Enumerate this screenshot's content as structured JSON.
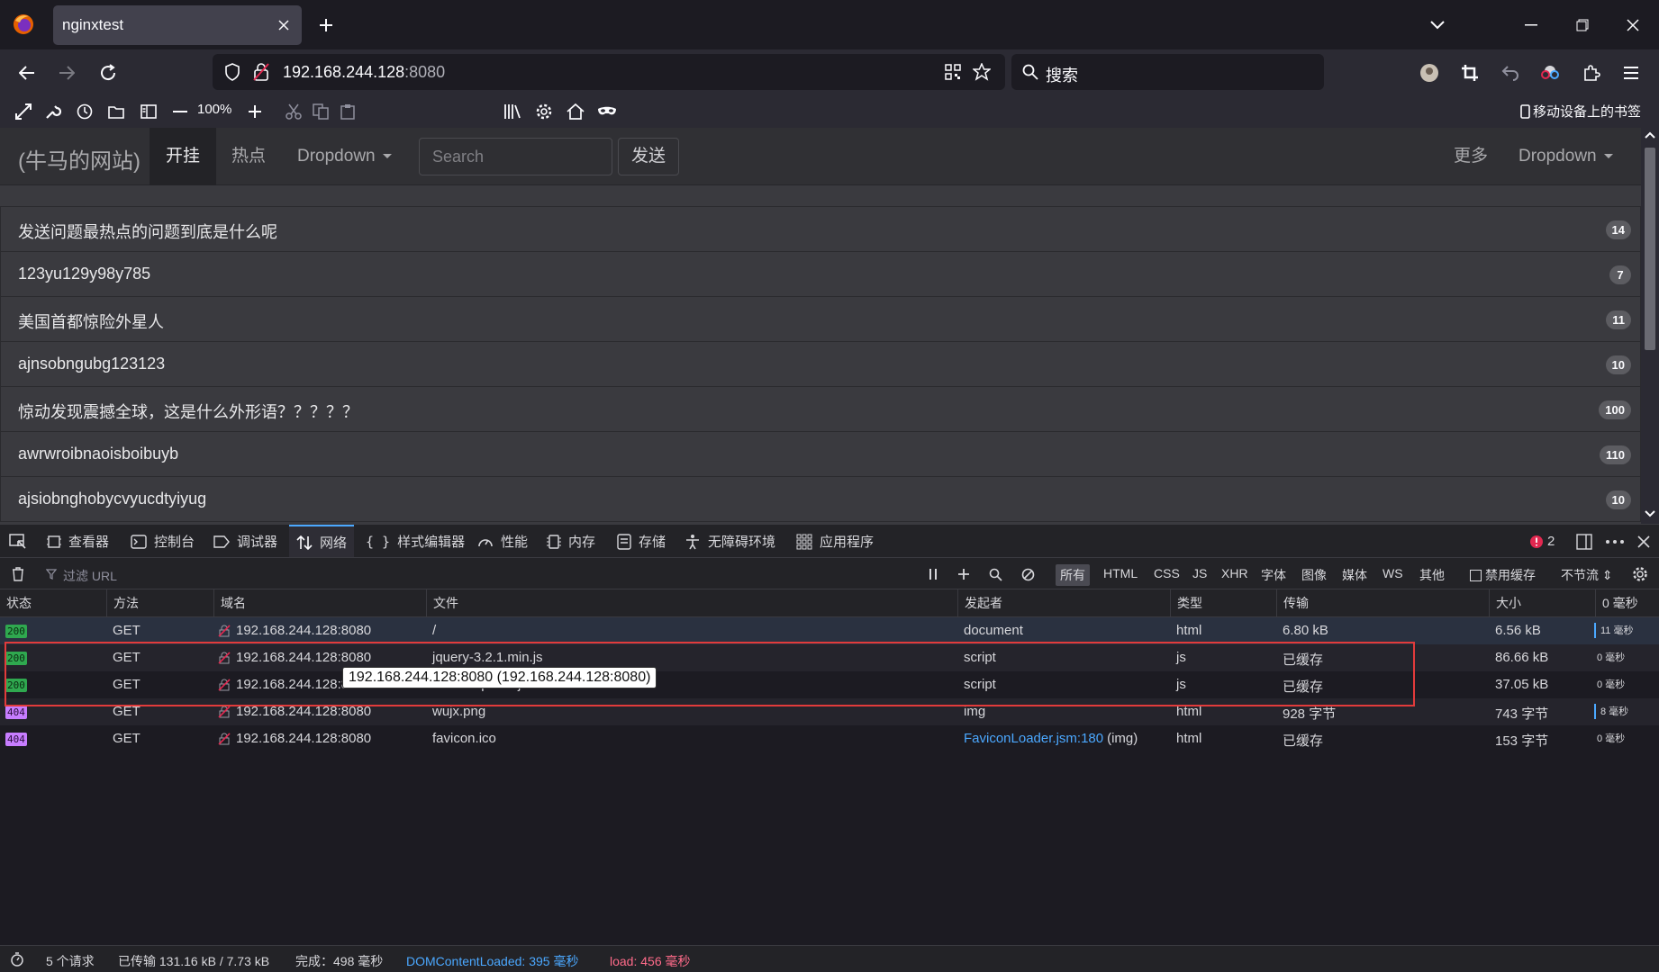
{
  "browser": {
    "tab_title": "nginxtest",
    "url_host": "192.168.244.128",
    "url_port": ":8080",
    "search_placeholder": "搜索",
    "zoom": "100%",
    "mobile_bookmarks": "移动设备上的书签"
  },
  "page": {
    "brand": "(牛马的网站)",
    "nav": [
      "开挂",
      "热点",
      "Dropdown"
    ],
    "search_placeholder": "Search",
    "send_button": "发送",
    "more": "更多",
    "dropdown_right": "Dropdown",
    "items": [
      {
        "text": "发送问题最热点的问题到底是什么呢",
        "badge": "14"
      },
      {
        "text": "123yu129y98y785",
        "badge": "7"
      },
      {
        "text": "美国首都惊险外星人",
        "badge": "11"
      },
      {
        "text": "ajnsobngubg123123",
        "badge": "10"
      },
      {
        "text": "惊动发现震撼全球，这是什么外形语？？？？？",
        "badge": "100"
      },
      {
        "text": "awrwroibnaoisboibuyb",
        "badge": "110"
      },
      {
        "text": "ajsiobnghobycvyucdtyiyug",
        "badge": "10"
      }
    ]
  },
  "devtools": {
    "tabs": [
      "查看器",
      "控制台",
      "调试器",
      "网络",
      "样式编辑器",
      "性能",
      "内存",
      "存储",
      "无障碍环境",
      "应用程序"
    ],
    "error_count": "2",
    "filter_placeholder": "过滤 URL",
    "type_filters": [
      "所有",
      "HTML",
      "CSS",
      "JS",
      "XHR",
      "字体",
      "图像",
      "媒体",
      "WS",
      "其他"
    ],
    "disable_cache": "禁用缓存",
    "throttle": "不节流 ⇕",
    "columns": [
      "状态",
      "方法",
      "域名",
      "文件",
      "发起者",
      "类型",
      "传输",
      "大小",
      "0 毫秒"
    ],
    "rows": [
      {
        "status": "200",
        "method": "GET",
        "domain": "192.168.244.128:8080",
        "file": "/",
        "initiator": "document",
        "initiator_link": "",
        "type": "html",
        "transfer": "6.80 kB",
        "size": "6.56 kB",
        "time": "11 毫秒"
      },
      {
        "status": "200",
        "method": "GET",
        "domain": "192.168.244.128:8080",
        "file": "jquery-3.2.1.min.js",
        "initiator": "script",
        "initiator_link": "",
        "type": "js",
        "transfer": "已缓存",
        "size": "86.66 kB",
        "time": "0 毫秒"
      },
      {
        "status": "200",
        "method": "GET",
        "domain": "192.168.244.128:8080",
        "file": "bootstrap.min.js",
        "initiator": "script",
        "initiator_link": "",
        "type": "js",
        "transfer": "已缓存",
        "size": "37.05 kB",
        "time": "0 毫秒"
      },
      {
        "status": "404",
        "method": "GET",
        "domain": "192.168.244.128:8080",
        "file": "wujx.png",
        "initiator": "img",
        "initiator_link": "",
        "type": "html",
        "transfer": "928 字节",
        "size": "743 字节",
        "time": "8 毫秒"
      },
      {
        "status": "404",
        "method": "GET",
        "domain": "192.168.244.128:8080",
        "file": "favicon.ico",
        "initiator": "(img)",
        "initiator_link": "FaviconLoader.jsm:180",
        "type": "html",
        "transfer": "已缓存",
        "size": "153 字节",
        "time": "0 毫秒"
      }
    ],
    "tooltip": "192.168.244.128:8080 (192.168.244.128:8080)",
    "status": {
      "requests": "5 个请求",
      "transferred": "已传输 131.16 kB / 7.73 kB",
      "finish": "完成：498 毫秒",
      "dcl": "DOMContentLoaded: 395 毫秒",
      "load": "load: 456 毫秒"
    }
  },
  "colors": {
    "accent": "#4ba8ff",
    "status200": "#2fa84f",
    "status404": "#c77dff",
    "highlight": "#e23b3b"
  }
}
